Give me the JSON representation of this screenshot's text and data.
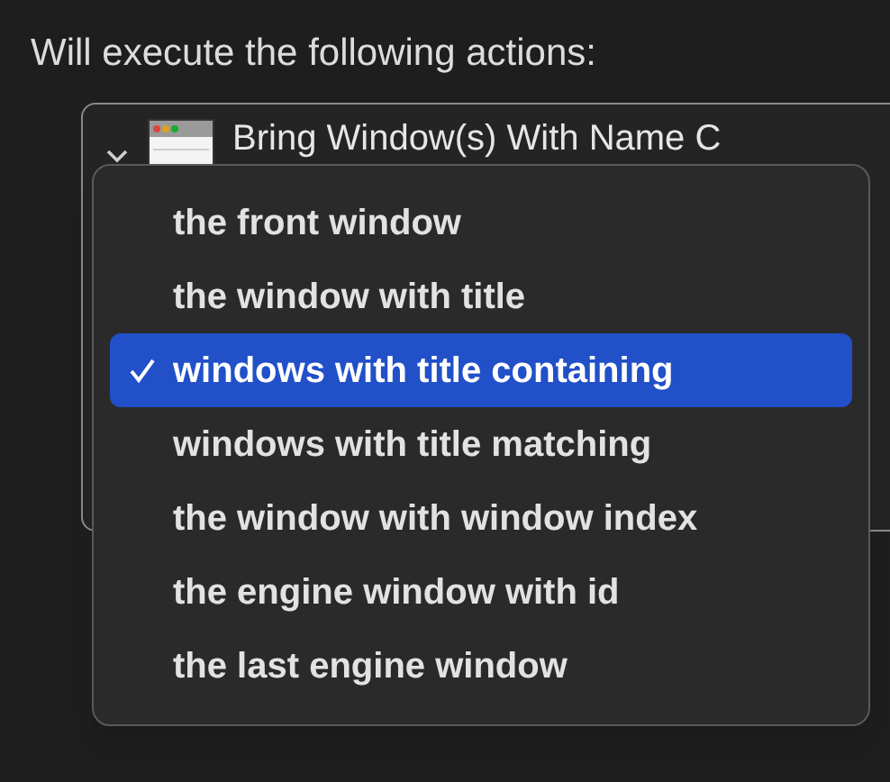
{
  "heading": "Will execute the following actions:",
  "action": {
    "title": "Bring Window(s) With Name C",
    "expanded": true
  },
  "menu": {
    "items": [
      {
        "label": "the front window",
        "selected": false
      },
      {
        "label": "the window with title",
        "selected": false
      },
      {
        "label": "windows with title containing",
        "selected": true
      },
      {
        "label": "windows with title matching",
        "selected": false
      },
      {
        "label": "the window with window index",
        "selected": false
      },
      {
        "label": "the engine window with id",
        "selected": false
      },
      {
        "label": "the last engine window",
        "selected": false
      }
    ]
  }
}
